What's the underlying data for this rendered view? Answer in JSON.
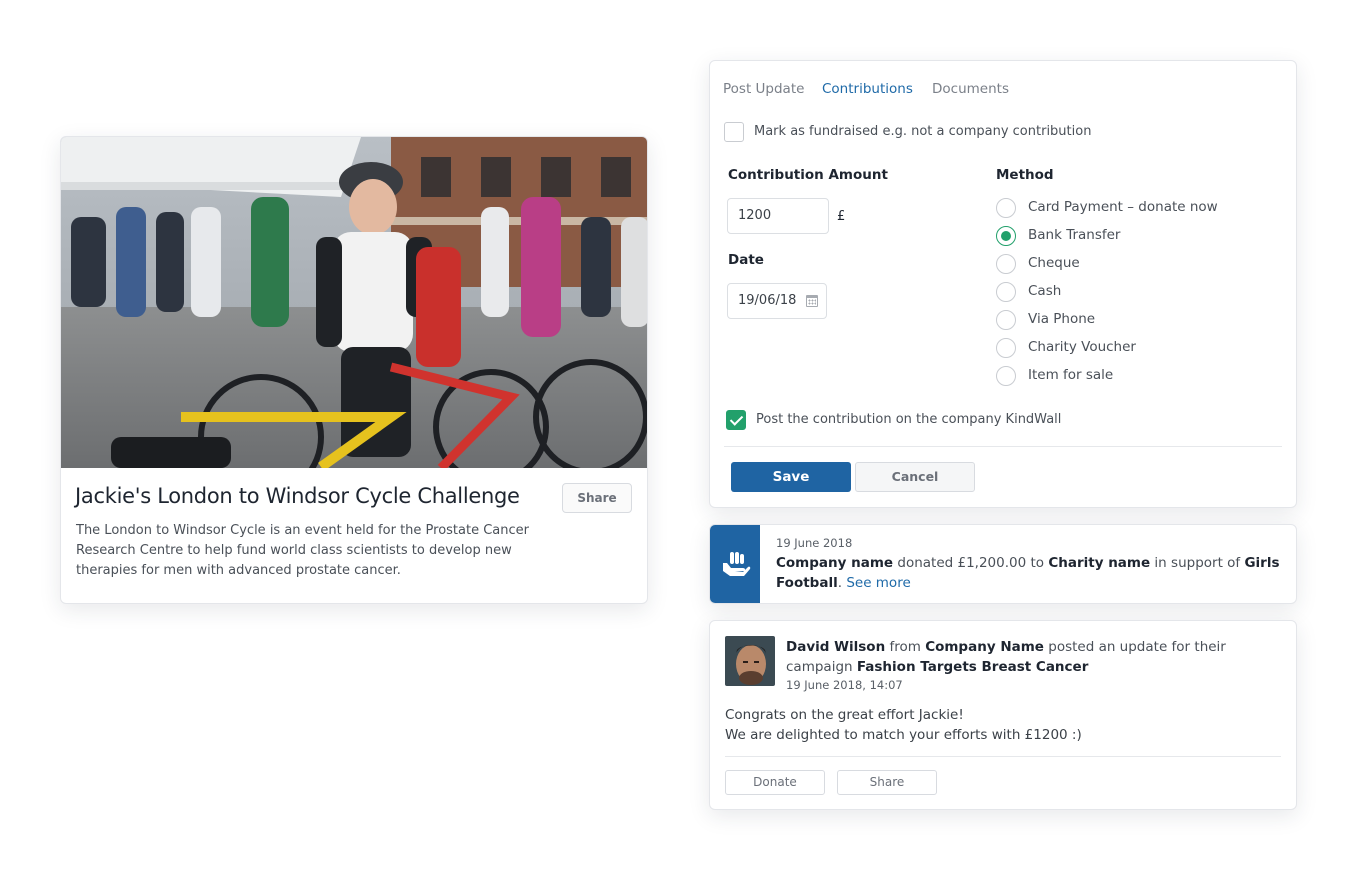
{
  "campaign": {
    "title": "Jackie's London to Windsor Cycle Challenge",
    "share_label": "Share",
    "description": "The London to Windsor Cycle is an event held for the Prostate Cancer Research Centre to help fund world class scientists to develop new therapies for men with advanced prostate cancer."
  },
  "form": {
    "tabs": [
      {
        "label": "Post Update",
        "active": false
      },
      {
        "label": "Contributions",
        "active": true
      },
      {
        "label": "Documents",
        "active": false
      }
    ],
    "fundraised_label": "Mark as fundraised e.g. not a company contribution",
    "fundraised_checked": false,
    "amount_label": "Contribution Amount",
    "amount_value": "1200",
    "currency": "£",
    "date_label": "Date",
    "date_value": "19/06/18",
    "method_label": "Method",
    "methods": [
      {
        "label": "Card Payment – donate now",
        "selected": false
      },
      {
        "label": "Bank Transfer",
        "selected": true
      },
      {
        "label": "Cheque",
        "selected": false
      },
      {
        "label": "Cash",
        "selected": false
      },
      {
        "label": "Via Phone",
        "selected": false
      },
      {
        "label": "Charity Voucher",
        "selected": false
      },
      {
        "label": "Item for sale",
        "selected": false
      }
    ],
    "kindwall_label": "Post the contribution on the company KindWall",
    "kindwall_checked": true,
    "save_label": "Save",
    "cancel_label": "Cancel"
  },
  "activity": {
    "date": "19 June 2018",
    "company": "Company name",
    "donated_text": " donated £1,200.00 to ",
    "charity": "Charity name",
    "support_text": " in support of ",
    "cause": "Girls Football",
    "period": ". ",
    "see_more": "See more"
  },
  "post": {
    "author": "David Wilson",
    "from_text": " from ",
    "company": "Company Name",
    "posted_text": " posted an update for their campaign ",
    "campaign": "Fashion Targets Breast Cancer",
    "timestamp": "19 June 2018, 14:07",
    "body_line1": "Congrats on the great effort Jackie!",
    "body_line2": "We are delighted to match your efforts with £1200 :)",
    "donate_label": "Donate",
    "share_label": "Share"
  },
  "colors": {
    "primary": "#1f64a3",
    "link": "#1f6aa8",
    "success": "#22a06b"
  },
  "icons": {
    "activity_icon": "hand-heart-icon",
    "date_icon": "calendar-icon"
  }
}
